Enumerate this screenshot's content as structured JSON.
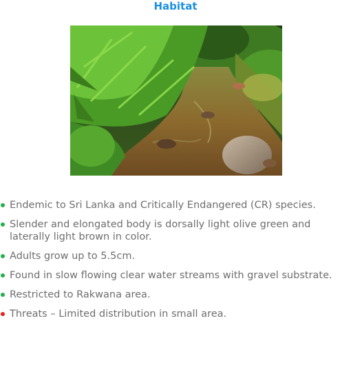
{
  "header": {
    "title": "Habitat"
  },
  "photo": {
    "description_icon": "stream-photo"
  },
  "facts": [
    {
      "text": "Endemic to Sri Lanka and Critically Endangered (CR) species.",
      "bullet_color": "#22b04b"
    },
    {
      "text": "Slender and elongated body is dorsally light olive green and laterally light brown in color.",
      "bullet_color": "#22b04b"
    },
    {
      "text": "Adults grow up to 5.5cm.",
      "bullet_color": "#22b04b"
    },
    {
      "text": "Found in slow flowing clear water streams with gravel substrate.",
      "bullet_color": "#22b04b"
    },
    {
      "text": "Restricted to Rakwana area.",
      "bullet_color": "#22b04b"
    },
    {
      "text": "Threats – Limited distribution in small area.",
      "bullet_color": "#e8231d"
    }
  ],
  "colors": {
    "title": "#1b8fe0",
    "body_text": "#6e6e6e",
    "bullet_default": "#22b04b",
    "bullet_threat": "#e8231d"
  }
}
